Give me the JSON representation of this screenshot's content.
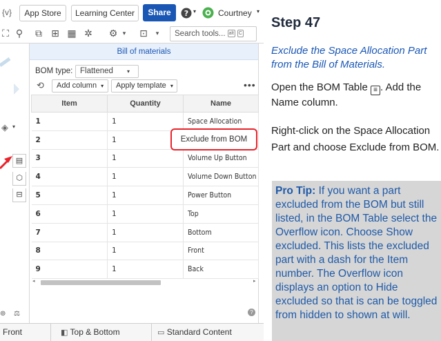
{
  "toolbar": {
    "variables_icon": "{v}",
    "app_store": "App Store",
    "learning_center": "Learning Center",
    "share": "Share",
    "user": "Courtney",
    "search_placeholder": "Search tools...",
    "search_shortcut_1": "alt",
    "search_shortcut_2": "C"
  },
  "bom": {
    "title": "Bill of materials",
    "type_label": "BOM type:",
    "type_value": "Flattened",
    "add_column": "Add column",
    "apply_template": "Apply template",
    "overflow": "•••",
    "columns": [
      "Item",
      "Quantity",
      "Name"
    ],
    "rows": [
      {
        "item": "1",
        "qty": "1",
        "name": "Space Allocation"
      },
      {
        "item": "2",
        "qty": "1",
        "name": ""
      },
      {
        "item": "3",
        "qty": "1",
        "name": "Volume Up Button"
      },
      {
        "item": "4",
        "qty": "1",
        "name": "Volume Down Button"
      },
      {
        "item": "5",
        "qty": "1",
        "name": "Power Button"
      },
      {
        "item": "6",
        "qty": "1",
        "name": "Top"
      },
      {
        "item": "7",
        "qty": "1",
        "name": "Bottom"
      },
      {
        "item": "8",
        "qty": "1",
        "name": "Front"
      },
      {
        "item": "9",
        "qty": "1",
        "name": "Back"
      }
    ],
    "context_menu_item": "Exclude from BOM"
  },
  "tabs": {
    "front": "Front",
    "top_bottom": "Top & Bottom",
    "standard_content": "Standard Content"
  },
  "instructions": {
    "title": "Step 47",
    "subtitle": "Exclude the Space Allocation Part from the Bill of Materials.",
    "p1": "Open the BOM Table",
    "p1b": ". Add the Name column.",
    "p2": "Right-click on the Space Allocation Part and choose Exclude from BOM.",
    "tip_label": "Pro Tip:",
    "tip_text": " If you want a part excluded from the BOM but still listed, in the BOM Table select the Overflow icon. Choose Show excluded. This lists the excluded part with a dash for the Item number. The Overflow icon displays an option to Hide excluded so that is can be toggled from hidden to shown at will."
  },
  "colors": {
    "accent": "#1a57b5",
    "callout_border": "#e8232b",
    "tip_bg": "#d6d6d6"
  }
}
